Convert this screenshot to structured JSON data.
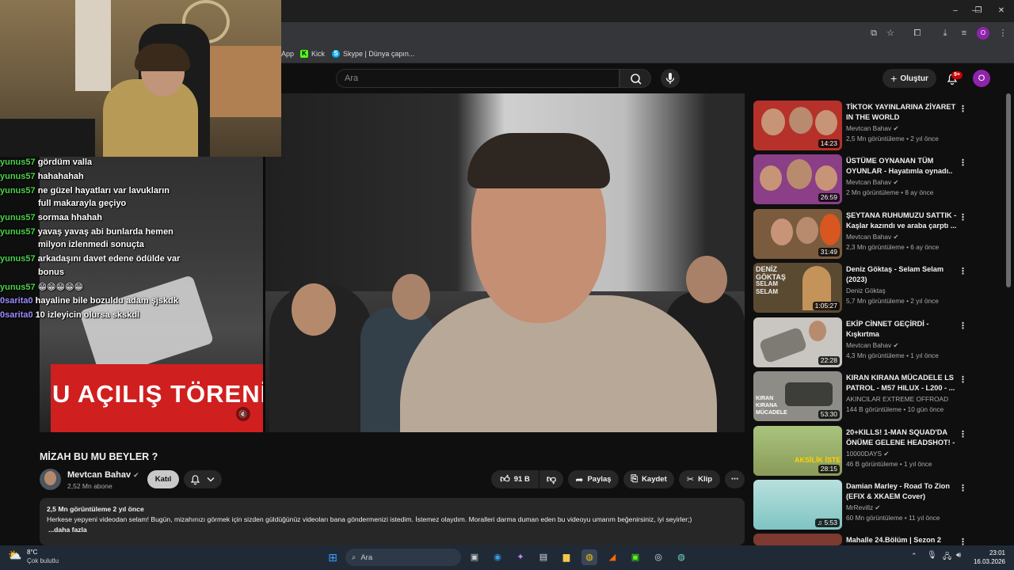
{
  "browser": {
    "bookmarks": [
      {
        "label": "App",
        "color": "#444"
      },
      {
        "label": "Kick",
        "color": "#53fc18"
      },
      {
        "label": "Skype | Dünya çapın...",
        "color": "#00aff0"
      }
    ],
    "profile_letter": "O"
  },
  "header": {
    "search_placeholder": "Ara",
    "create_label": "Oluştur",
    "notif_count": "9+",
    "avatar_letter": "O"
  },
  "video": {
    "overlay_text": "U AÇILIŞ TÖRENİ",
    "title": "MİZAH BU MU BEYLER ?"
  },
  "chat": [
    {
      "user": "yunus57",
      "msg": "gördüm valla",
      "alt": false
    },
    {
      "user": "yunus57",
      "msg": "hahahahah",
      "alt": false
    },
    {
      "user": "yunus57",
      "msg": "ne güzel hayatları var lavukların",
      "alt": false
    },
    {
      "user": "",
      "msg": "full makarayla geçiyo",
      "alt": false
    },
    {
      "user": "yunus57",
      "msg": "sormaa hhahah",
      "alt": false
    },
    {
      "user": "yunus57",
      "msg": "yavaş yavaş abi bunlarda hemen",
      "alt": false
    },
    {
      "user": "",
      "msg": "milyon izlenmedi sonuçta",
      "alt": false
    },
    {
      "user": "yunus57",
      "msg": "arkadaşını davet edene ödülde var",
      "alt": false
    },
    {
      "user": "",
      "msg": "bonus",
      "alt": false
    },
    {
      "user": "yunus57",
      "msg": "😁😁😁😁😁",
      "alt": false
    },
    {
      "user": "0sarita0",
      "msg": "hayaline bile bozuldu adam şjskdk",
      "alt": true
    },
    {
      "user": "0sarita0",
      "msg": "10 izleyicin olursa skskdl",
      "alt": true
    }
  ],
  "channel": {
    "name": "Mevtcan Bahav",
    "subs": "2,52 Mn abone",
    "join_label": "Katıl"
  },
  "actions": {
    "likes": "91 B",
    "share": "Paylaş",
    "save": "Kaydet",
    "clip": "Klip"
  },
  "description": {
    "meta": "2,5 Mn görüntüleme  2 yıl önce",
    "text": "Herkese yepyeni videodan selam! Bugün, mizahınızı görmek için sizden güldüğünüz videoları bana göndermenizi istedim. İstemez olaydım. Moralleri darma duman eden bu videoyu umarım beğenirsiniz, iyi seyirler;)",
    "more": "...daha fazla"
  },
  "recommendations": [
    {
      "title": "TİKTOK YAYINLARINA ZİYARET IN THE WORLD",
      "channel": "Mevtcan Bahav",
      "verified": true,
      "meta": "2,5 Mn görüntüleme • 2 yıl önce",
      "duration": "14:23",
      "color": "#b6312a"
    },
    {
      "title": "ÜSTÜME OYNANAN TÜM OYUNLAR - Hayatımla oynadı..",
      "channel": "Mevtcan Bahav",
      "verified": true,
      "meta": "2 Mn görüntüleme • 8 ay önce",
      "duration": "26:59",
      "color": "#8a3f86"
    },
    {
      "title": "ŞEYTANA RUHUMUZU SATTIK - Kaşlar kazındı ve araba çarptı ...",
      "channel": "Mevtcan Bahav",
      "verified": true,
      "meta": "2,3 Mn görüntüleme • 6 ay önce",
      "duration": "31:49",
      "color": "#7a5b3d"
    },
    {
      "title": "Deniz Göktaş - Selam Selam (2023)",
      "channel": "Deniz Göktaş",
      "verified": false,
      "meta": "5,7 Mn görüntüleme • 2 yıl önce",
      "duration": "1:05:27",
      "color": "#5b4a32"
    },
    {
      "title": "EKİP CİNNET GEÇİRDİ - Kışkırtma",
      "channel": "Mevtcan Bahav",
      "verified": true,
      "meta": "4,3 Mn görüntüleme • 1 yıl önce",
      "duration": "22:28",
      "color": "#c9c5c0"
    },
    {
      "title": "KIRAN KIRANA MÜCADELE LS PATROL - M57 HILUX - L200 - ...",
      "channel": "AKINCILAR EXTREME OFFROAD",
      "verified": false,
      "meta": "144 B görüntüleme • 10 gün önce",
      "duration": "53:30",
      "color": "#8e8c86"
    },
    {
      "title": "20+KILLS! 1-MAN SQUAD'DA ÖNÜME GELENE HEADSHOT! - ...",
      "channel": "10000DAYS",
      "verified": true,
      "meta": "46 B görüntüleme • 1 yıl önce",
      "duration": "28:15",
      "color": "#8fa26a"
    },
    {
      "title": "Damian Marley - Road To Zion (EFIX & XKAEM Cover)",
      "channel": "MrRevillz",
      "verified": true,
      "meta": "60 Mn görüntüleme • 11 yıl önce",
      "duration": "5:53",
      "color": "#9fd3d2"
    },
    {
      "title": "Mahalle 24.Bölüm | Sezon 2",
      "channel": "",
      "verified": false,
      "meta": "",
      "duration": "",
      "color": "#7c3a30"
    }
  ],
  "overlays": {
    "thumb_deniz": "DENİZ GÖKTAŞ",
    "thumb_selam": "SELAM SELAM",
    "thumb_kiran": "KIRAN KIRANA MÜCADELE",
    "thumb_aksilik": "AKSİLİK İSTE"
  },
  "taskbar": {
    "temp": "8°C",
    "weather": "Çok bulutlu",
    "search": "Ara",
    "time": "23:01",
    "date": "16.03.2026"
  }
}
